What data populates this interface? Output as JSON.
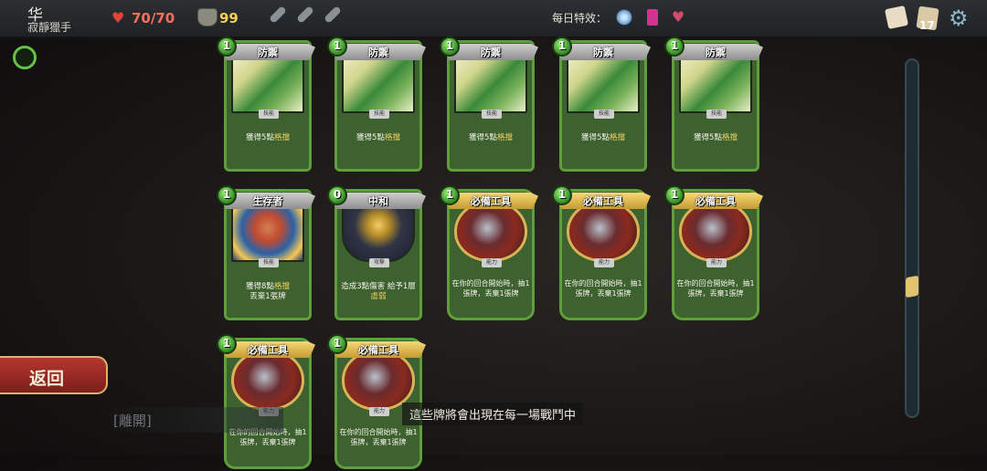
{
  "topbar": {
    "char_name": "华",
    "char_title": "寂靜獵手",
    "hp": "70/70",
    "gold": "99",
    "daily_label": "每日特效：",
    "deck_count": "17",
    "icons": [
      "heart-icon",
      "gold-bag-icon",
      "potion-slot-icon",
      "winged-boots-icon",
      "card-modifier-icon",
      "heart-modifier-icon",
      "map-icon",
      "deck-icon",
      "gear-icon"
    ]
  },
  "side": {
    "back_label": "返回",
    "leave_label": "[離開]",
    "info_text": "這些牌將會出現在每一場戰鬥中"
  },
  "cards": [
    {
      "name": "防禦",
      "cost": "1",
      "type": "技能",
      "kind": "skill",
      "desc_pre": "獲得5點",
      "kw": "格擋",
      "desc_post": ""
    },
    {
      "name": "防禦",
      "cost": "1",
      "type": "技能",
      "kind": "skill",
      "desc_pre": "獲得5點",
      "kw": "格擋",
      "desc_post": ""
    },
    {
      "name": "防禦",
      "cost": "1",
      "type": "技能",
      "kind": "skill",
      "desc_pre": "獲得5點",
      "kw": "格擋",
      "desc_post": ""
    },
    {
      "name": "防禦",
      "cost": "1",
      "type": "技能",
      "kind": "skill",
      "desc_pre": "獲得5點",
      "kw": "格擋",
      "desc_post": ""
    },
    {
      "name": "防禦",
      "cost": "1",
      "type": "技能",
      "kind": "skill",
      "desc_pre": "獲得5點",
      "kw": "格擋",
      "desc_post": ""
    },
    {
      "name": "生存者",
      "cost": "1",
      "type": "技能",
      "kind": "skill-fist",
      "desc_pre": "獲得8點",
      "kw": "格擋",
      "desc_post": "丟棄1張牌"
    },
    {
      "name": "中和",
      "cost": "0",
      "type": "攻擊",
      "kind": "attack",
      "desc_pre": "造成3點傷害 給予1層",
      "kw": "虛弱",
      "desc_post": ""
    },
    {
      "name": "必備工具",
      "cost": "1",
      "type": "能力",
      "kind": "power",
      "desc_pre": "在你的回合開始時，抽1張牌，丟棄1張牌",
      "kw": "",
      "desc_post": ""
    },
    {
      "name": "必備工具",
      "cost": "1",
      "type": "能力",
      "kind": "power",
      "desc_pre": "在你的回合開始時，抽1張牌，丟棄1張牌",
      "kw": "",
      "desc_post": ""
    },
    {
      "name": "必備工具",
      "cost": "1",
      "type": "能力",
      "kind": "power",
      "desc_pre": "在你的回合開始時，抽1張牌，丟棄1張牌",
      "kw": "",
      "desc_post": ""
    },
    {
      "name": "必備工具",
      "cost": "1",
      "type": "能力",
      "kind": "power",
      "desc_pre": "在你的回合開始時，抽1張牌，丟棄1張牌",
      "kw": "",
      "desc_post": ""
    },
    {
      "name": "必備工具",
      "cost": "1",
      "type": "能力",
      "kind": "power",
      "desc_pre": "在你的回合開始時，抽1張牌，丟棄1張牌",
      "kw": "",
      "desc_post": ""
    }
  ]
}
